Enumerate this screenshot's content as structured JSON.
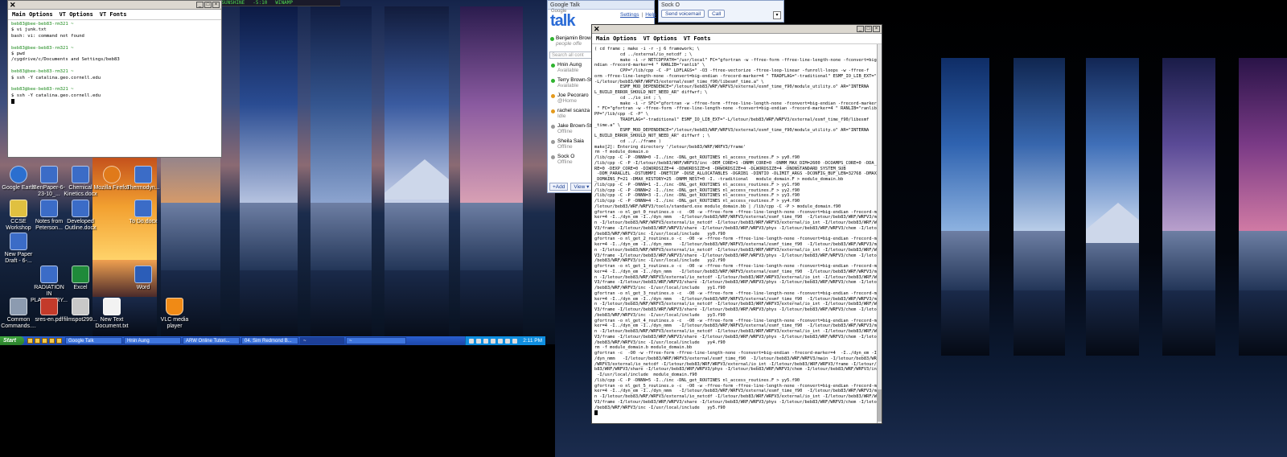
{
  "winamp": {
    "track": "04. SIM REDMOND BAND - RAY OF SUNSHINE",
    "time": "-5:10",
    "app_name": "WINAMP"
  },
  "xterm_left": {
    "menu": [
      "Main Options",
      "VT Options",
      "VT Fonts"
    ],
    "lines": [
      {
        "text": "beb83@bee-beb83-rm321 ~",
        "prompt": true
      },
      {
        "text": "$ vi junk.txt",
        "prompt": false
      },
      {
        "text": "bash: vi: command not found",
        "prompt": false
      },
      {
        "text": "",
        "prompt": false
      },
      {
        "text": "beb83@bee-beb83-rm321 ~",
        "prompt": true
      },
      {
        "text": "$ pwd",
        "prompt": false
      },
      {
        "text": "/cygdrive/c/Documents and Settings/beb83",
        "prompt": false
      },
      {
        "text": "",
        "prompt": false
      },
      {
        "text": "beb83@bee-beb83-rm321 ~",
        "prompt": true
      },
      {
        "text": "$ ssh -Y catalina.geo.cornell.edu",
        "prompt": false
      },
      {
        "text": "",
        "prompt": false
      },
      {
        "text": "beb83@bee-beb83-rm321 ~",
        "prompt": true
      },
      {
        "text": "$ ssh -Y catalina.geo.cornell.edu",
        "prompt": false
      }
    ]
  },
  "desktop_icons": [
    {
      "label": "Google Earth",
      "color": "#2b6fcf"
    },
    {
      "label": "BenPaper-6-23-10_...",
      "color": "#3b6cc7"
    },
    {
      "label": "Chemical Kinetics.docx",
      "color": "#3b6cc7"
    },
    {
      "label": "Mozilla Firefox",
      "color": "#e07a1a"
    },
    {
      "label": "Thermodyn...",
      "color": "#3b6cc7"
    },
    {
      "label": "CCSE Workshop",
      "color": "#e0c040"
    },
    {
      "label": "Notes from Peterson...",
      "color": "#3b6cc7"
    },
    {
      "label": "Developed Outline.docx",
      "color": "#3b6cc7"
    },
    {
      "label": "To Do.docx",
      "color": "#3b6cc7"
    },
    {
      "label": "New Paper Draft - 6-...",
      "color": "#3b6cc7"
    },
    {
      "label": "RADIATION IN PLANETARY...",
      "color": "#3b6cc7"
    },
    {
      "label": "Excel",
      "color": "#1f8a3a"
    },
    {
      "label": "Word",
      "color": "#2b5db8"
    },
    {
      "label": "Common Commands....",
      "color": "#8c9bb0"
    },
    {
      "label": "sres-en.pdf",
      "color": "#c33a2a"
    },
    {
      "label": "filmspot299...",
      "color": "#c8c8c8"
    },
    {
      "label": "New Text Document.txt",
      "color": "#f2f2f2"
    },
    {
      "label": "VLC media player",
      "color": "#f08a15"
    }
  ],
  "taskbar": {
    "start_label": "Start",
    "items": [
      {
        "label": "Google Talk",
        "active": false
      },
      {
        "label": "Hnin Aung",
        "active": false
      },
      {
        "label": "ARW Online Tutori...",
        "active": false
      },
      {
        "label": "04. Sim Redmond B...",
        "active": false
      },
      {
        "label": "~",
        "active": true
      },
      {
        "label": "~",
        "active": false
      }
    ],
    "clock": "2:11 PM"
  },
  "gtalk": {
    "title": "Google Talk",
    "logo_small": "Google",
    "logo_text": "talk",
    "link_settings": "Settings",
    "link_help": "Help",
    "me_name": "Benjamin Brow",
    "me_status": "people offe",
    "search_placeholder": "Search all cont",
    "contacts": [
      {
        "name": "Hnin Aung",
        "status": "Available",
        "state": "green"
      },
      {
        "name": "Terry Brown-Sti",
        "status": "Available",
        "state": "green"
      },
      {
        "name": "Joe Pecoraro",
        "status": "@Home",
        "state": "orange"
      },
      {
        "name": "rachel scanza",
        "status": "Idle",
        "state": "orange"
      },
      {
        "name": "Jake Brown-Ste",
        "status": "Offline",
        "state": "gray"
      },
      {
        "name": "Sheila Saia",
        "status": "Offline",
        "state": "gray"
      },
      {
        "name": "Sock O",
        "status": "Offline",
        "state": "gray"
      }
    ],
    "add_label": "+Add",
    "view_label": "View ▾"
  },
  "chat": {
    "title": "Sock O",
    "voicemail_label": "Send voicemail",
    "call_label": "Call"
  },
  "xterm_big": {
    "menu": [
      "Main Options",
      "VT Options",
      "VT Fonts"
    ],
    "lines": [
      "( cd frame ; make -i -r -j 6 framework; \\",
      "          cd ../external/io_netcdf ; \\",
      "          make -i -r NETCDFPATH=\"/usr/local\" FC=\"gfortran -w -ffree-form -ffree-line-length-none -fconvert=big-e",
      "ndian -frecord-marker=4 \" RANLIB=\"ranlib\" \\",
      "          CPP=\"/lib/cpp -C -P\" LDFLAGS=\" -O3 -ftree-vectorize -ftree-loop-linear -funroll-loops -w -ffree-f",
      "orm -ffree-line-length-none -fconvert=big-endian -frecord-marker=4 \" TRADFLAG=\"-traditional\" ESMF_IO_LIB_EXT=\"",
      "-L/letour/beb83/WRF/WRFV3/external/esmf_time_f90/libesmf_time.a\" \\",
      "          ESMF_MOD_DEPENDENCE=\"/letour/beb83/WRF/WRFV3/external/esmf_time_f90/module_utility.o\" AR=\"INTERNA",
      "L_BUILD_ERROR_SHOULD_NOT_NEED_AR\" diffwrf; \\",
      "          cd ../io_int ; \\",
      "          make -i -r SFC=\"gfortran -w -ffree-form -ffree-line-length-none -fconvert=big-endian -frecord-marker=4",
      " \" FC=\"gfortran -w -ffree-form -ffree-line-length-none -fconvert=big-endian -frecord-marker=4 \" RANLIB=\"ranlib\" C",
      "PP=\"/lib/cpp -C -P\" \\",
      "          TRADFLAG=\"-traditional\" ESMF_IO_LIB_EXT=\"-L/letour/beb83/WRF/WRFV3/external/esmf_time_f90/libesmf",
      "_time.a\" \\",
      "          ESMF_MOD_DEPENDENCE=\"/letour/beb83/WRF/WRFV3/external/esmf_time_f90/module_utility.o\" AR=\"INTERNA",
      "L_BUILD_ERROR_SHOULD_NOT_NEED_AR\" diffwrf ; \\",
      "          cd ../../frame )",
      "make[2]: Entering directory '/letour/beb83/WRF/WRFV3/frame'",
      "rm -f module_domain.o",
      "/lib/cpp -C -P -DNNN=0 -I../inc -DNL_get_ROUTINES nl_access_routines.F > yy0.f90",
      "/lib/cpp -C -P -I/letour/beb83/WRF/WRFV3/inc -DEM_CORE=1 -DNMM_CORE=0 -DNMM_MAX_DIM=2600 -DCOAMPS_CORE=0 -DDA_CO",
      "RE=0 -DEXP_CORE=0 -DIWORDSIZE=4 -DDWORDSIZE=8 -DRWORDSIZE=4 -DLWORDSIZE=4 -DNONSTANDARD_SYSTEM_SUB",
      " -DDM_PARALLEL -DSTUBMPI -DNETCDF -DUSE_ALLOCATABLES -DGRIB1 -DINTIO -DLIMIT_ARGS -DCONFIG_BUF_LEN=32768 -DMAX",
      "_DOMAINS_F=21 -DMAX_HISTORY=25 -DNMM_NEST=0 -I. -traditional   module_domain.F > module_domain.bb",
      "/lib/cpp -C -P -DNNN=1 -I../inc -DNL_get_ROUTINES nl_access_routines.F > yy1.f90",
      "/lib/cpp -C -P -DNNN=2 -I../inc -DNL_get_ROUTINES nl_access_routines.F > yy2.f90",
      "/lib/cpp -C -P -DNNN=3 -I../inc -DNL_get_ROUTINES nl_access_routines.F > yy3.f90",
      "/lib/cpp -C -P -DNNN=4 -I../inc -DNL_get_ROUTINES nl_access_routines.F > yy4.f90",
      "/letour/beb83/WRF/WRFV3/tools/standard.exe module_domain.bb | /lib/cpp -C -P > module_domain.f90",
      "gfortran -o nl_get_0_routines.o -c  -O0 -w -ffree-form -ffree-line-length-none -fconvert=big-endian -frecord-mar",
      "ker=4 -I../dyn_em -I../dyn_nmm   -I/letour/beb83/WRF/WRFV3/external/esmf_time_f90  -I/letour/beb83/WRF/WRFV3/mai",
      "n -I/letour/beb83/WRF/WRFV3/external/io_netcdf -I/letour/beb83/WRF/WRFV3/external/io_int -I/letour/beb83/WRF/WRF",
      "V3/frame -I/letour/beb83/WRF/WRFV3/share -I/letour/beb83/WRF/WRFV3/phys -I/letour/beb83/WRF/WRFV3/chem -I/letour",
      "/beb83/WRF/WRFV3/inc -I/usr/local/include   yy0.f90",
      "gfortran -o nl_get_2_routines.o -c  -O0 -w -ffree-form -ffree-line-length-none -fconvert=big-endian -frecord-mar",
      "ker=4 -I../dyn_em -I../dyn_nmm   -I/letour/beb83/WRF/WRFV3/external/esmf_time_f90  -I/letour/beb83/WRF/WRFV3/mai",
      "n -I/letour/beb83/WRF/WRFV3/external/io_netcdf -I/letour/beb83/WRF/WRFV3/external/io_int -I/letour/beb83/WRF/WRF",
      "V3/frame -I/letour/beb83/WRF/WRFV3/share -I/letour/beb83/WRF/WRFV3/phys -I/letour/beb83/WRF/WRFV3/chem -I/letour",
      "/beb83/WRF/WRFV3/inc -I/usr/local/include   yy2.f90",
      "gfortran -o nl_get_1_routines.o -c  -O0 -w -ffree-form -ffree-line-length-none -fconvert=big-endian -frecord-mar",
      "ker=4 -I../dyn_em -I../dyn_nmm   -I/letour/beb83/WRF/WRFV3/external/esmf_time_f90  -I/letour/beb83/WRF/WRFV3/mai",
      "n -I/letour/beb83/WRF/WRFV3/external/io_netcdf -I/letour/beb83/WRF/WRFV3/external/io_int -I/letour/beb83/WRF/WRF",
      "V3/frame -I/letour/beb83/WRF/WRFV3/share -I/letour/beb83/WRF/WRFV3/phys -I/letour/beb83/WRF/WRFV3/chem -I/letour",
      "/beb83/WRF/WRFV3/inc -I/usr/local/include   yy1.f90",
      "gfortran -o nl_get_3_routines.o -c  -O0 -w -ffree-form -ffree-line-length-none -fconvert=big-endian -frecord-mar",
      "ker=4 -I../dyn_em -I../dyn_nmm   -I/letour/beb83/WRF/WRFV3/external/esmf_time_f90  -I/letour/beb83/WRF/WRFV3/mai",
      "n -I/letour/beb83/WRF/WRFV3/external/io_netcdf -I/letour/beb83/WRF/WRFV3/external/io_int -I/letour/beb83/WRF/WRF",
      "V3/frame -I/letour/beb83/WRF/WRFV3/share -I/letour/beb83/WRF/WRFV3/phys -I/letour/beb83/WRF/WRFV3/chem -I/letour",
      "/beb83/WRF/WRFV3/inc -I/usr/local/include   yy3.f90",
      "gfortran -o nl_get_4_routines.o -c  -O0 -w -ffree-form -ffree-line-length-none -fconvert=big-endian -frecord-mar",
      "ker=4 -I../dyn_em -I../dyn_nmm   -I/letour/beb83/WRF/WRFV3/external/esmf_time_f90  -I/letour/beb83/WRF/WRFV3/mai",
      "n -I/letour/beb83/WRF/WRFV3/external/io_netcdf -I/letour/beb83/WRF/WRFV3/external/io_int -I/letour/beb83/WRF/WRF",
      "V3/frame -I/letour/beb83/WRF/WRFV3/share -I/letour/beb83/WRF/WRFV3/phys -I/letour/beb83/WRF/WRFV3/chem -I/letour",
      "/beb83/WRF/WRFV3/inc -I/usr/local/include   yy4.f90",
      "rm -f module_domain.b module_domain.bb",
      "gfortran -c  -O0 -w -ffree-form -ffree-line-length-none -fconvert=big-endian -frecord-marker=4  -I../dyn_em -I..",
      "/dyn_nmm   -I/letour/beb83/WRF/WRFV3/external/esmf_time_f90  -I/letour/beb83/WRF/WRFV3/main -I/letour/beb83/WRF",
      "/WRFV3/external/io_netcdf -I/letour/beb83/WRF/WRFV3/external/io_int -I/letour/beb83/WRF/WRFV3/frame -I/letour/be",
      "b83/WRF/WRFV3/share -I/letour/beb83/WRF/WRFV3/phys -I/letour/beb83/WRF/WRFV3/chem -I/letour/beb83/WRF/WRFV3/inc",
      " -I/usr/local/include  module_domain.f90",
      "/lib/cpp -C -P -DNNN=5 -I../inc -DNL_get_ROUTINES nl_access_routines.F > yy5.f90",
      "gfortran -o nl_get_5_routines.o -c  -O0 -w -ffree-form -ffree-line-length-none -fconvert=big-endian -frecord-mar",
      "ker=4 -I../dyn_em -I../dyn_nmm   -I/letour/beb83/WRF/WRFV3/external/esmf_time_f90  -I/letour/beb83/WRF/WRFV3/mai",
      "n -I/letour/beb83/WRF/WRFV3/external/io_netcdf -I/letour/beb83/WRF/WRFV3/external/io_int -I/letour/beb83/WRF/WRF",
      "V3/frame -I/letour/beb83/WRF/WRFV3/share -I/letour/beb83/WRF/WRFV3/phys -I/letour/beb83/WRF/WRFV3/chem -I/letour",
      "/beb83/WRF/WRFV3/inc -I/usr/local/include   yy5.f90"
    ]
  }
}
